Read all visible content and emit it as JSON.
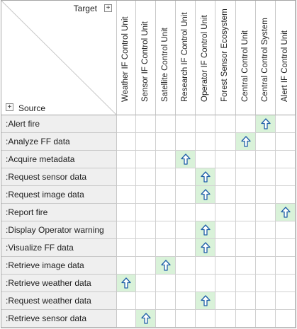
{
  "corner": {
    "target_label": "Target",
    "source_label": "Source",
    "expand_symbol": "+"
  },
  "columns": [
    "Weather IF Control Unit",
    "Sensor IF Control Unit",
    "Satellite Control Unit",
    "Research IF Control Unit",
    "Operator IF Control Unit",
    "Forest Sensor Ecosystem",
    "Central Control Unit",
    "Central Control System",
    "Alert IF Control Unit"
  ],
  "rows": [
    {
      "label": ":Alert fire",
      "target_col": 7
    },
    {
      "label": ":Analyze FF data",
      "target_col": 6
    },
    {
      "label": ":Acquire metadata",
      "target_col": 3
    },
    {
      "label": ":Request sensor data",
      "target_col": 4
    },
    {
      "label": ":Request image data",
      "target_col": 4
    },
    {
      "label": ":Report fire",
      "target_col": 8
    },
    {
      "label": ":Display Operator warning",
      "target_col": 4
    },
    {
      "label": ":Visualize FF data",
      "target_col": 4
    },
    {
      "label": ":Retrieve image data",
      "target_col": 2
    },
    {
      "label": ":Retrieve weather data",
      "target_col": 0
    },
    {
      "label": ":Request weather data",
      "target_col": 4
    },
    {
      "label": ":Retrieve sensor data",
      "target_col": 1
    }
  ],
  "relation_icon": "up-arrow-icon",
  "colors": {
    "filled_cell": "#d9f2d9",
    "arrow": "#1f5fa8",
    "row_header": "#efefef"
  }
}
